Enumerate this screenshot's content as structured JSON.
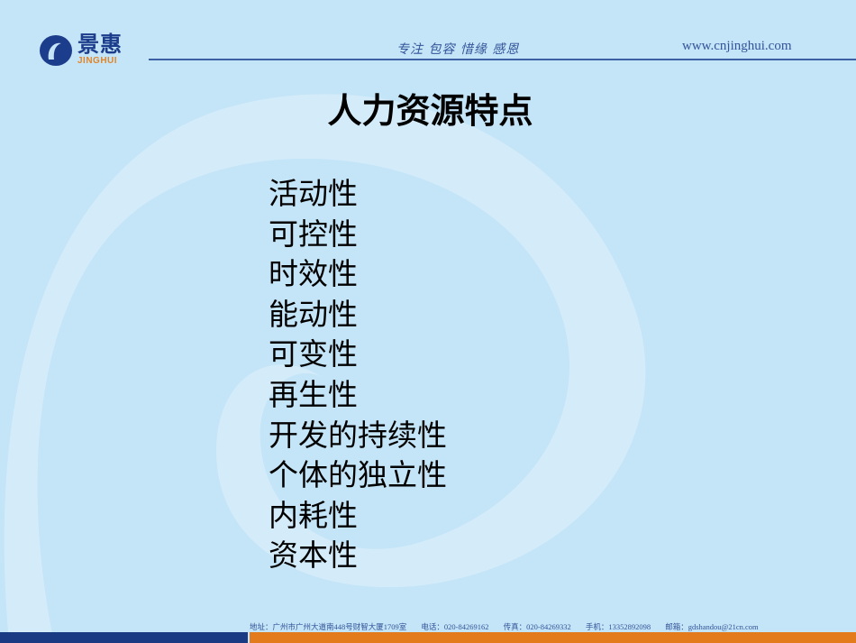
{
  "header": {
    "logo_cn": "景惠",
    "logo_en": "JINGHUI",
    "slogan": "专注  包容  惜缘  感恩",
    "website": "www.cnjinghui.com"
  },
  "slide": {
    "title": "人力资源特点",
    "items": [
      "活动性",
      "可控性",
      "时效性",
      "能动性",
      "可变性",
      "再生性",
      "开发的持续性",
      "个体的独立性",
      "内耗性",
      "资本性"
    ]
  },
  "footer": {
    "address": "地址：广州市广州大道南448号财智大厦1709室",
    "phone": "电话：020-84269162",
    "fax": "传真：020-84269332",
    "mobile": "手机：13352892098",
    "email": "邮箱：gdshandou@21cn.com"
  },
  "colors": {
    "background": "#c4e4f7",
    "brand_blue": "#1a3a84",
    "brand_orange": "#e37b1c"
  }
}
